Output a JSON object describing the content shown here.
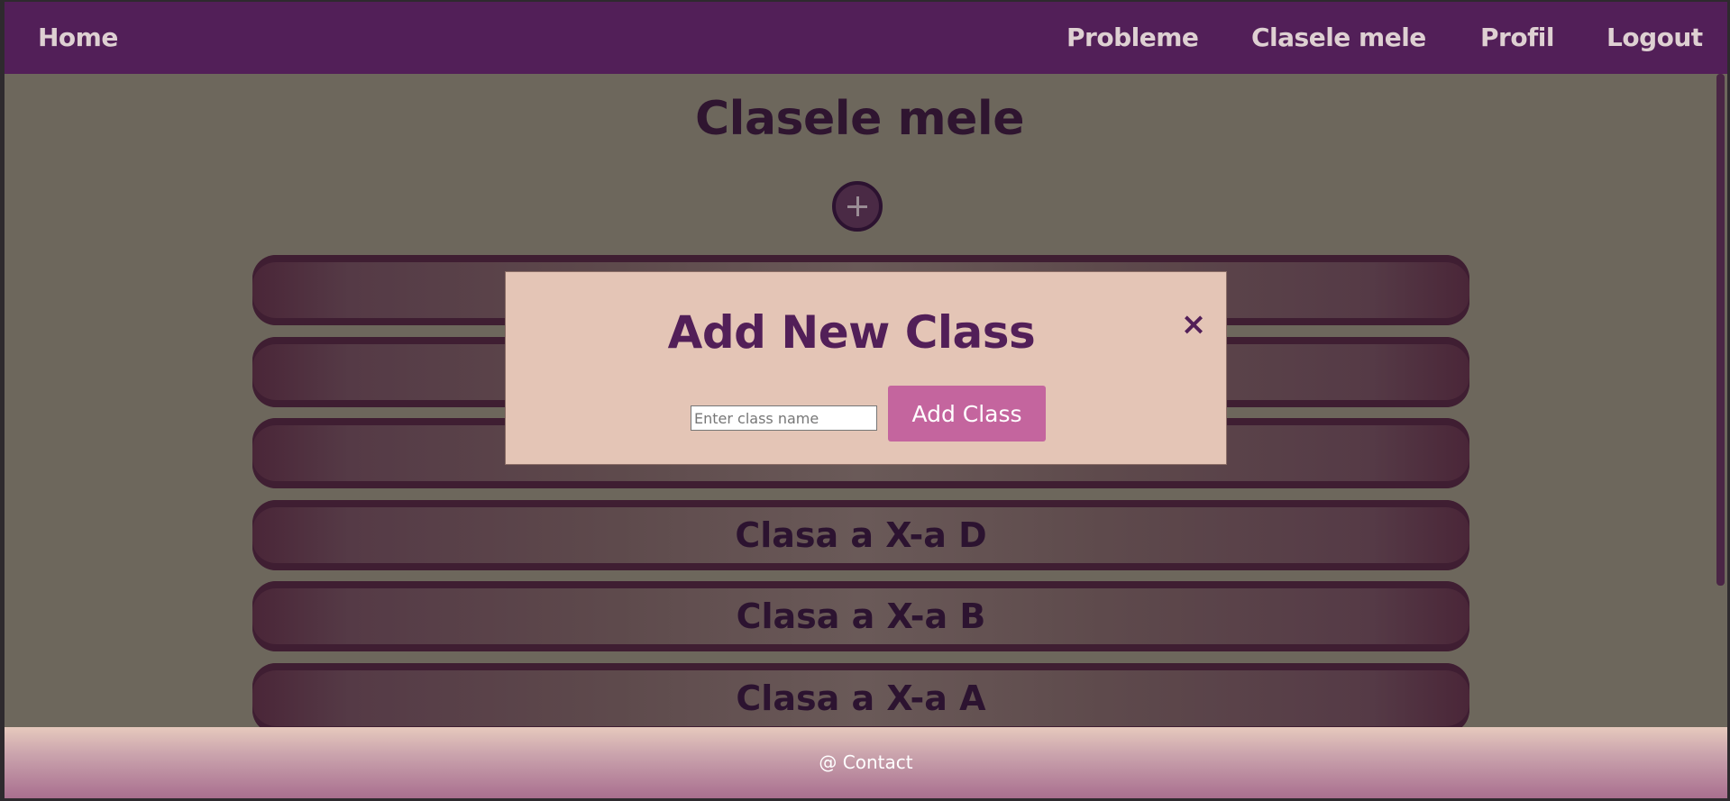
{
  "nav": {
    "home": "Home",
    "links": [
      "Probleme",
      "Clasele mele",
      "Profil",
      "Logout"
    ]
  },
  "page": {
    "title": "Clasele mele"
  },
  "classes": [
    "",
    "",
    "",
    "Clasa a X-a D",
    "Clasa a X-a B",
    "Clasa a X-a A"
  ],
  "modal": {
    "title": "Add New Class",
    "close": "×",
    "input_placeholder": "Enter class name",
    "submit_label": "Add Class"
  },
  "footer": {
    "contact": "@ Contact"
  },
  "colors": {
    "nav_bg": "#521f58",
    "page_bg": "#6d675c",
    "modal_bg": "#e4c5b6",
    "accent": "#c4659e"
  }
}
